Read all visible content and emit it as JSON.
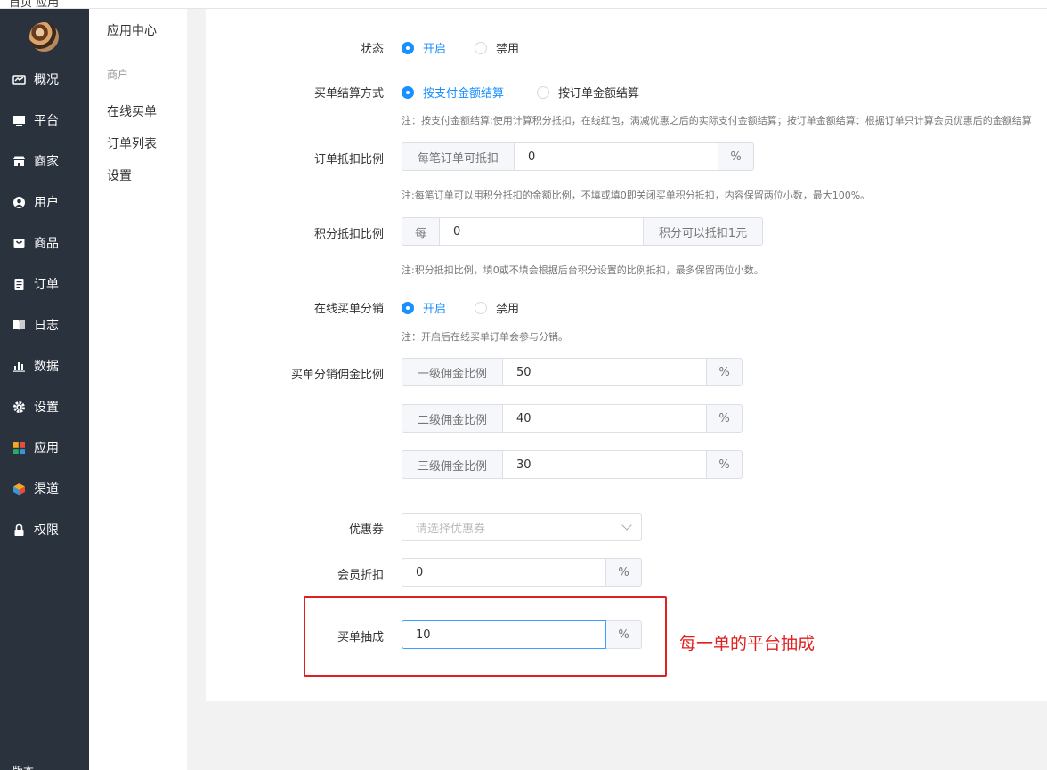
{
  "topbar": {
    "text": "首页 应用"
  },
  "sidebar": {
    "items": [
      {
        "label": "概况",
        "icon": "chart-icon"
      },
      {
        "label": "平台",
        "icon": "monitor-icon"
      },
      {
        "label": "商家",
        "icon": "store-icon"
      },
      {
        "label": "用户",
        "icon": "user-icon"
      },
      {
        "label": "商品",
        "icon": "bag-icon"
      },
      {
        "label": "订单",
        "icon": "order-icon"
      },
      {
        "label": "日志",
        "icon": "book-icon"
      },
      {
        "label": "数据",
        "icon": "bar-chart-icon"
      },
      {
        "label": "设置",
        "icon": "gear-icon"
      },
      {
        "label": "应用",
        "icon": "apps-grid-icon"
      },
      {
        "label": "渠道",
        "icon": "cube-icon"
      },
      {
        "label": "权限",
        "icon": "lock-icon"
      }
    ],
    "bottom_text": "版本"
  },
  "submenu": {
    "title": "应用中心",
    "group": "商户",
    "items": [
      "在线买单",
      "订单列表",
      "设置"
    ]
  },
  "form": {
    "status": {
      "label": "状态",
      "options": [
        "开启",
        "禁用"
      ],
      "selected": "开启"
    },
    "settlement": {
      "label": "买单结算方式",
      "options": [
        "按支付金额结算",
        "按订单金额结算"
      ],
      "selected": "按支付金额结算",
      "note": "注：按支付金额结算:使用计算积分抵扣，在线红包，满减优惠之后的实际支付金额结算；按订单金额结算：根据订单只计算会员优惠后的金额结算"
    },
    "order_deduct": {
      "label": "订单抵扣比例",
      "prefix": "每笔订单可抵扣",
      "value": "0",
      "suffix": "%",
      "note": "注:每笔订单可以用积分抵扣的金额比例，不填或填0即关闭买单积分抵扣，内容保留两位小数，最大100%。"
    },
    "points_deduct": {
      "label": "积分抵扣比例",
      "prefix": "每",
      "value": "0",
      "suffix": "积分可以抵扣1元",
      "note": "注:积分抵扣比例，填0或不填会根据后台积分设置的比例抵扣，最多保留两位小数。"
    },
    "distribution": {
      "label": "在线买单分销",
      "options": [
        "开启",
        "禁用"
      ],
      "selected": "开启",
      "note": "注：开启后在线买单订单会参与分销。"
    },
    "commission": {
      "label": "买单分销佣金比例",
      "levels": [
        {
          "prefix": "一级佣金比例",
          "value": "50",
          "suffix": "%"
        },
        {
          "prefix": "二级佣金比例",
          "value": "40",
          "suffix": "%"
        },
        {
          "prefix": "三级佣金比例",
          "value": "30",
          "suffix": "%"
        }
      ]
    },
    "coupon": {
      "label": "优惠券",
      "placeholder": "请选择优惠券"
    },
    "member_discount": {
      "label": "会员折扣",
      "value": "0",
      "suffix": "%"
    },
    "platform_cut": {
      "label": "买单抽成",
      "value": "10",
      "suffix": "%"
    }
  },
  "annotation": {
    "text": "每一单的平台抽成",
    "color": "#e02020"
  },
  "colors": {
    "sidebar_bg": "#2a323d",
    "accent": "#1890ff",
    "highlight": "#e02020"
  }
}
